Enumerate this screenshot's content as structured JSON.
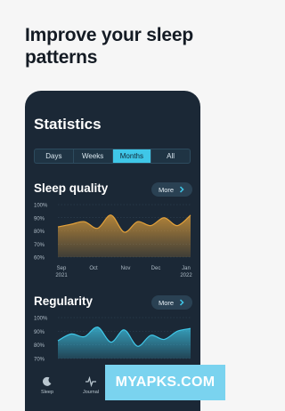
{
  "headline": "Improve your sleep patterns",
  "statistics": {
    "title": "Statistics",
    "segments": [
      "Days",
      "Weeks",
      "Months",
      "All"
    ],
    "active_segment": "Months"
  },
  "sleep_quality": {
    "title": "Sleep quality",
    "more_label": "More",
    "color": "#e3a13a",
    "chart_data": {
      "type": "area",
      "y_tick_labels": [
        "100%",
        "90%",
        "80%",
        "70%",
        "60%"
      ],
      "ylim": [
        60,
        100
      ],
      "x_tick_labels": [
        "Sep\n2021",
        "Oct",
        "Nov",
        "Dec",
        "Jan\n2022"
      ],
      "x": [
        0,
        0.1,
        0.2,
        0.3,
        0.4,
        0.5,
        0.6,
        0.7,
        0.8,
        0.9,
        1.0
      ],
      "values": [
        83,
        85,
        87,
        82,
        92,
        79,
        87,
        84,
        90,
        84,
        92
      ]
    }
  },
  "regularity": {
    "title": "Regularity",
    "more_label": "More",
    "color": "#3fc7e8",
    "chart_data": {
      "type": "area",
      "y_tick_labels": [
        "100%",
        "90%",
        "80%",
        "70%"
      ],
      "ylim": [
        70,
        100
      ],
      "x": [
        0,
        0.1,
        0.2,
        0.3,
        0.4,
        0.5,
        0.6,
        0.7,
        0.8,
        0.9,
        1.0
      ],
      "values": [
        83,
        88,
        86,
        93,
        82,
        91,
        79,
        87,
        84,
        90,
        92
      ]
    }
  },
  "tabs": [
    {
      "label": "Sleep",
      "icon": "moon-icon"
    },
    {
      "label": "Journal",
      "icon": "pulse-icon"
    }
  ],
  "watermark": "MYAPKS.COM"
}
